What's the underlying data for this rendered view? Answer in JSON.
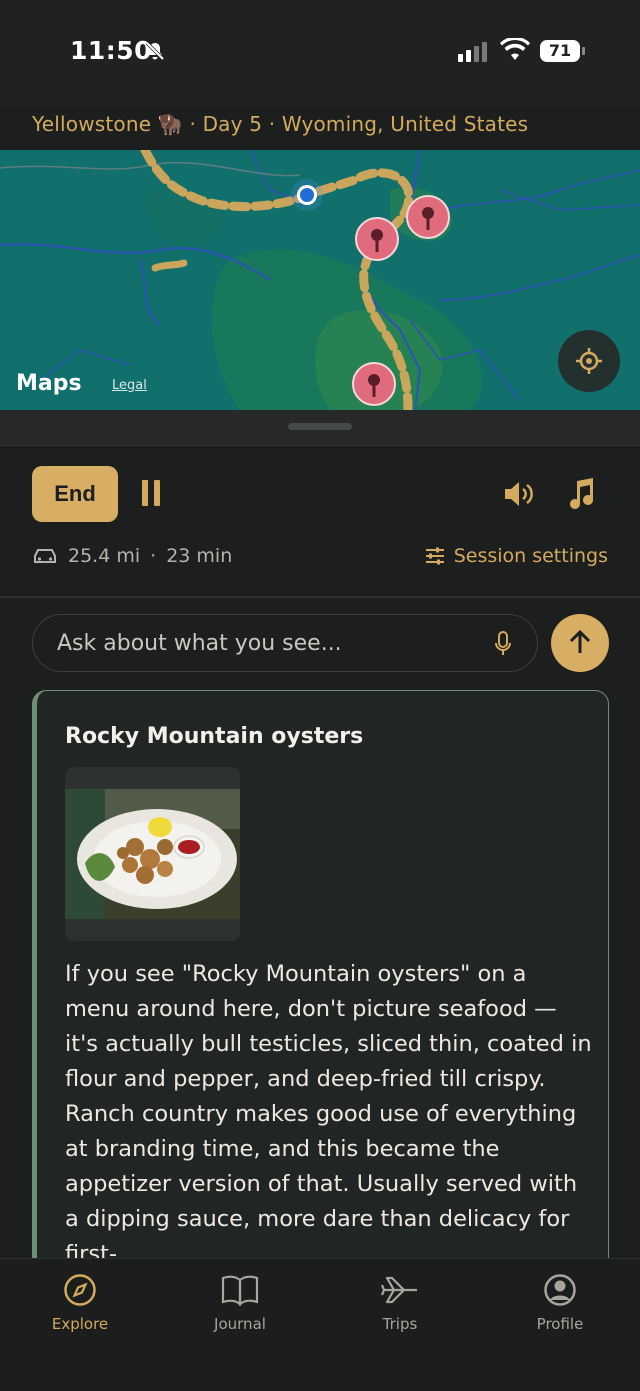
{
  "status": {
    "time": "11:50",
    "battery": "71"
  },
  "trip": {
    "header": "Yellowstone 🦬 · Day 5 · Wyoming, United States"
  },
  "map": {
    "attribution": "Maps",
    "legal": "Legal"
  },
  "controls": {
    "end_label": "End",
    "distance": "25.4 mi",
    "separator": "·",
    "duration": "23 min",
    "session_settings_label": "Session settings"
  },
  "ask": {
    "placeholder": "Ask about what you see..."
  },
  "card": {
    "title": "Rocky Mountain oysters",
    "body": "If you see \"Rocky Mountain oysters\" on a menu around here, don't picture seafood — it's actually bull testicles, sliced thin, coated in flour and pepper, and deep-fried till crispy. Ranch country makes good use of everything at branding time, and this became the appetizer version of that. Usually served with a dipping sauce, more dare than delicacy for first-"
  },
  "tabs": [
    {
      "label": "Explore",
      "icon": "compass-icon",
      "active": true
    },
    {
      "label": "Journal",
      "icon": "book-icon",
      "active": false
    },
    {
      "label": "Trips",
      "icon": "plane-icon",
      "active": false
    },
    {
      "label": "Profile",
      "icon": "user-circle-icon",
      "active": false
    }
  ],
  "colors": {
    "accent": "#d8ae64",
    "map_water": "#0f6e6b",
    "pin": "#e06b7c",
    "background": "#1c1f1d"
  }
}
